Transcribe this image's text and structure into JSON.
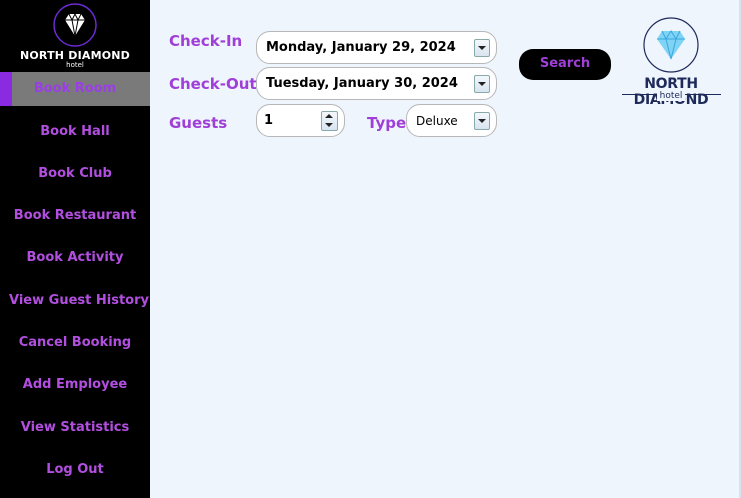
{
  "sidebar": {
    "logo": {
      "brand": "NORTH DIAMOND",
      "sub": "hotel"
    },
    "items": [
      {
        "label": "Book Room",
        "active": true
      },
      {
        "label": "Book Hall"
      },
      {
        "label": "Book Club"
      },
      {
        "label": "Book Restaurant"
      },
      {
        "label": "Book Activity"
      },
      {
        "label": "View Guest History"
      },
      {
        "label": "Cancel Booking"
      },
      {
        "label": "Add Employee"
      },
      {
        "label": "View Statistics"
      },
      {
        "label": "Log Out"
      }
    ]
  },
  "form": {
    "checkin_label": "Check-In",
    "checkin_value": "Monday, January 29, 2024",
    "checkout_label": "Check-Out",
    "checkout_value": "Tuesday, January 30, 2024",
    "guests_label": "Guests",
    "guests_value": "1",
    "type_label": "Type",
    "type_value": "Deluxe",
    "search_label": "Search"
  },
  "main_logo": {
    "brand": "NORTH DIAMOND",
    "sub": "hotel"
  },
  "colors": {
    "accent": "#a03fd8",
    "sidebar_bg": "#000000",
    "page_bg": "#eef5fd",
    "active_bg": "#7a7a7a"
  }
}
